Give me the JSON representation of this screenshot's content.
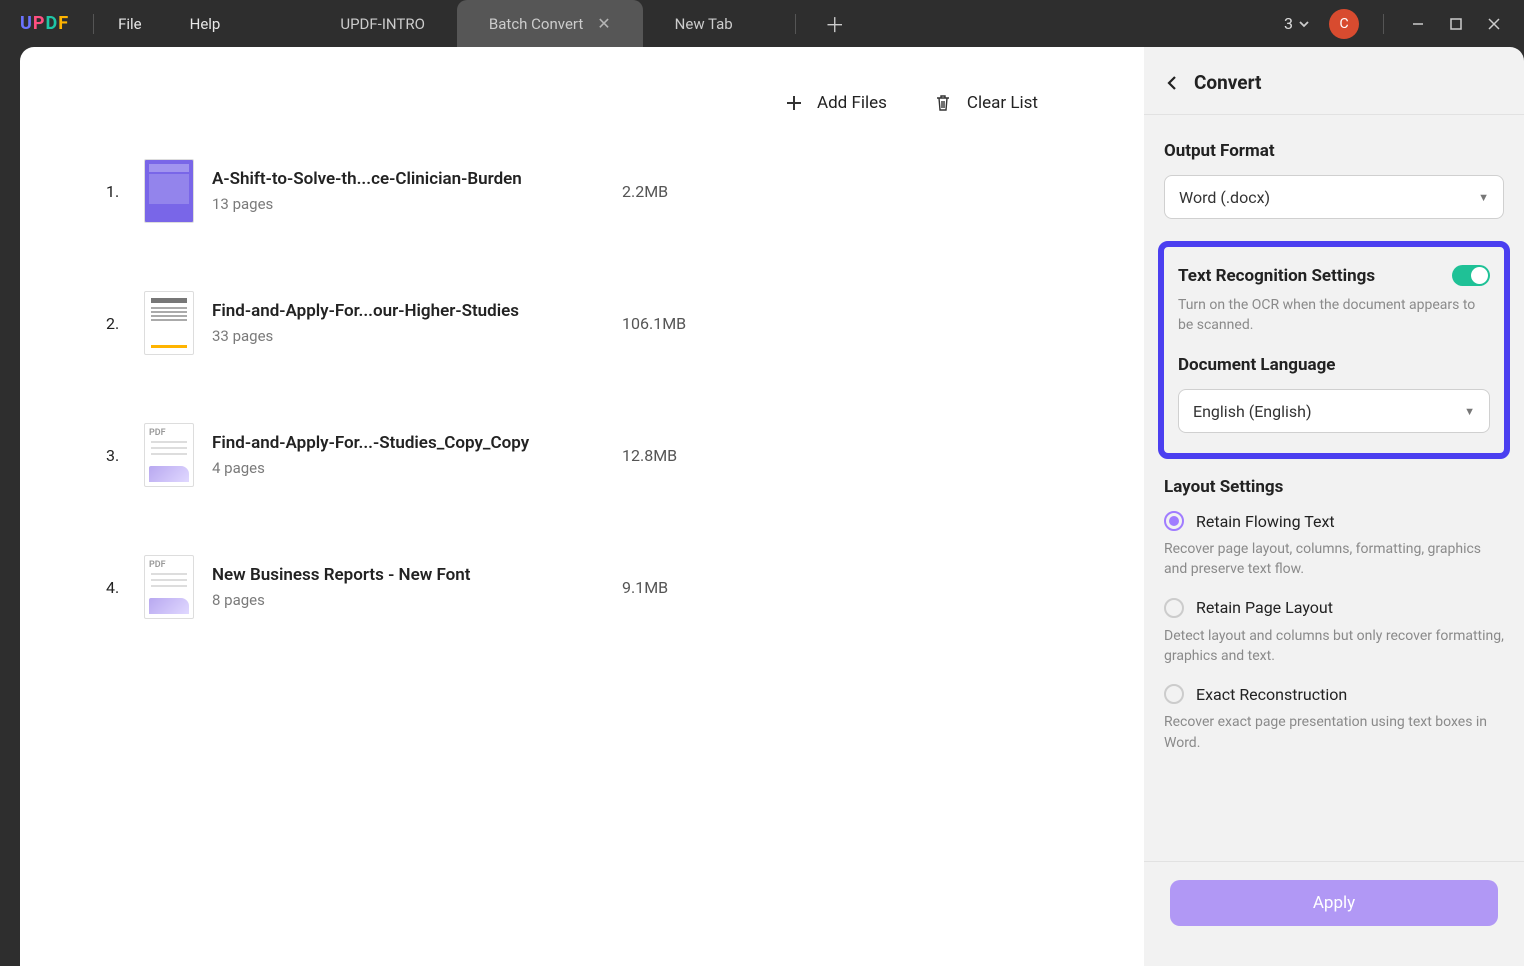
{
  "titlebar": {
    "logo_text": "UPDF",
    "menu": {
      "file": "File",
      "help": "Help"
    },
    "tabs": [
      {
        "label": "UPDF-INTRO",
        "active": false
      },
      {
        "label": "Batch Convert",
        "active": true
      },
      {
        "label": "New Tab",
        "active": false
      }
    ],
    "count": "3",
    "avatar_initial": "C"
  },
  "toolbar": {
    "add_files": "Add Files",
    "clear_list": "Clear List"
  },
  "files": [
    {
      "num": "1.",
      "name": "A-Shift-to-Solve-th...ce-Clinician-Burden",
      "pages": "13 pages",
      "size": "2.2MB",
      "thumb": "purple"
    },
    {
      "num": "2.",
      "name": "Find-and-Apply-For...our-Higher-Studies",
      "pages": "33 pages",
      "size": "106.1MB",
      "thumb": "text"
    },
    {
      "num": "3.",
      "name": "Find-and-Apply-For...-Studies_Copy_Copy",
      "pages": "4 pages",
      "size": "12.8MB",
      "thumb": "pdf"
    },
    {
      "num": "4.",
      "name": "New Business Reports - New Font",
      "pages": "8 pages",
      "size": "9.1MB",
      "thumb": "pdf"
    }
  ],
  "side": {
    "title": "Convert",
    "output_label": "Output Format",
    "output_value": "Word (.docx)",
    "ocr": {
      "title": "Text Recognition Settings",
      "hint": "Turn on the OCR when the document appears to be scanned.",
      "lang_label": "Document Language",
      "lang_value": "English (English)"
    },
    "layout": {
      "title": "Layout Settings",
      "options": [
        {
          "label": "Retain Flowing Text",
          "hint": "Recover page layout, columns, formatting, graphics and preserve text flow.",
          "selected": true
        },
        {
          "label": "Retain Page Layout",
          "hint": "Detect layout and columns but only recover formatting, graphics and text.",
          "selected": false
        },
        {
          "label": "Exact Reconstruction",
          "hint": "Recover exact page presentation using text boxes in Word.",
          "selected": false
        }
      ]
    },
    "apply": "Apply"
  }
}
